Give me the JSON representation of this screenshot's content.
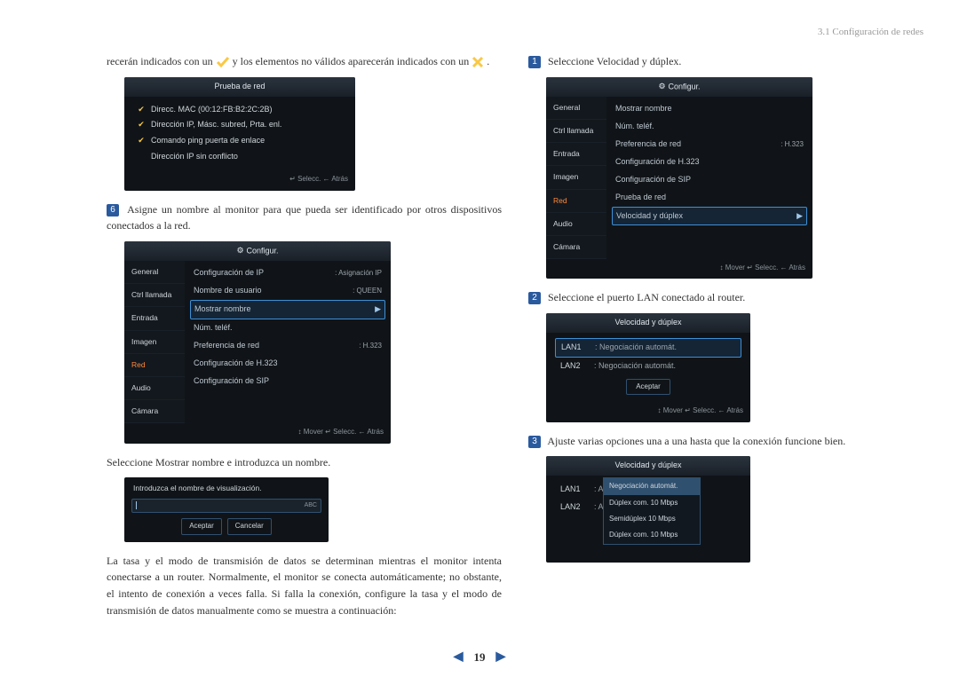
{
  "breadcrumb": "3.1 Configuración de redes",
  "page_number": "19",
  "left": {
    "intro_a": "recerán indicados con un ",
    "intro_b": " y los elementos no válidos aparecerán indicados con un ",
    "intro_c": ".",
    "osd1": {
      "title": "Prueba de red",
      "r1": "Direcc. MAC (00:12:FB:B2:2C:2B)",
      "r2": "Dirección IP, Másc. subred, Prta. enl.",
      "r3": "Comando ping puerta de enlace",
      "r4": "Dirección IP sin conflicto",
      "footer": "↵ Selecc.   ← Atrás"
    },
    "step6_num": "6",
    "step6_text": "Asigne un nombre al monitor para que pueda ser identificado por otros dispositivos conectados a la red.",
    "cfg": {
      "title": "Configur.",
      "tabs": {
        "t1": "General",
        "t2": "Ctrl llamada",
        "t3": "Entrada",
        "t4": "Imagen",
        "t5": "Red",
        "t6": "Audio",
        "t7": "Cámara"
      },
      "fields": {
        "f1k": "Configuración de IP",
        "f1v": ": Asignación IP",
        "f2k": "Nombre de usuario",
        "f2v": ": QUEEN",
        "f3k": "Mostrar nombre",
        "f4k": "Núm. teléf.",
        "f5k": "Preferencia de red",
        "f5v": ": H.323",
        "f6k": "Configuración de H.323",
        "f7k": "Configuración de SIP"
      },
      "footer": "↕ Mover   ↵ Selecc.   ← Atrás"
    },
    "sel_mostrar": "Seleccione Mostrar nombre e introduzca un nombre.",
    "input": {
      "label": "Introduzca el nombre de visualización.",
      "abc": "ABC",
      "ok": "Aceptar",
      "cancel": "Cancelar"
    },
    "para2": "La tasa y el modo de transmisión de datos se determinan mientras el monitor intenta conectarse a un router. Normalmente, el monitor se conecta automáti­camente; no obstante, el intento de conexión a veces falla. Si falla la conexión, configure la tasa y el modo de transmisión de datos manualmente como se muestra a continuación:"
  },
  "right": {
    "step1_num": "1",
    "step1_text": "Seleccione Velocidad y dúplex.",
    "cfg": {
      "title": "Configur.",
      "tabs": {
        "t1": "General",
        "t2": "Ctrl llamada",
        "t3": "Entrada",
        "t4": "Imagen",
        "t5": "Red",
        "t6": "Audio",
        "t7": "Cámara"
      },
      "fields": {
        "f1k": "Mostrar nombre",
        "f2k": "Núm. teléf.",
        "f3k": "Preferencia de red",
        "f3v": ": H.323",
        "f4k": "Configuración de H.323",
        "f5k": "Configuración de SIP",
        "f6k": "Prueba de red",
        "f7k": "Velocidad y dúplex"
      },
      "footer": "↕ Mover   ↵ Selecc.   ← Atrás"
    },
    "step2_num": "2",
    "step2_text": "Seleccione el puerto LAN conectado al router.",
    "vd1": {
      "title": "Velocidad y dúplex",
      "lan1": "LAN1",
      "lan1v": ": Negociación automát.",
      "lan2": "LAN2",
      "lan2v": ": Negociación automát.",
      "accept": "Aceptar",
      "footer": "↕ Mover   ↵ Selecc.   ← Atrás"
    },
    "step3_num": "3",
    "step3_text": "Ajuste varias opciones una a una hasta que la conexión funcione bien.",
    "vd2": {
      "title": "Velocidad y dúplex",
      "lan1": "LAN1",
      "lan1v": ": Au",
      "lan2": "LAN2",
      "lan2v": ": Au",
      "m1": "Negociación automát.",
      "m2": "Dúplex com. 10 Mbps",
      "m3": "Semidúplex 10 Mbps",
      "m4": "Dúplex com. 10 Mbps"
    }
  }
}
